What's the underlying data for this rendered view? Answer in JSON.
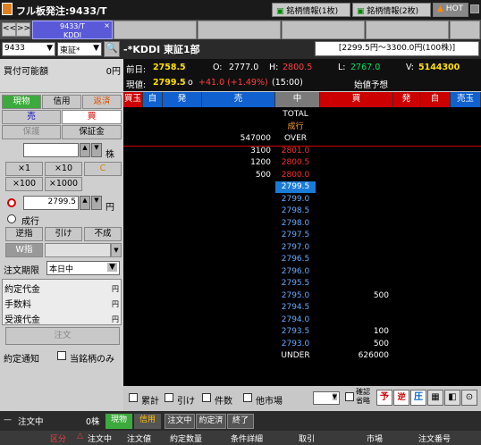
{
  "window": {
    "title": "フル板発注:9433/T",
    "btn_brand1": "銘柄情報(1枚)",
    "btn_brand2": "銘柄情報(2枚)",
    "btn_hot": "HOT"
  },
  "tabs": {
    "nav_prev": "<<",
    "nav_next": ">>",
    "active_code": "9433/T",
    "active_name": "KDDI",
    "close": "×"
  },
  "symbol": {
    "code": "9433",
    "market": "東証*",
    "name": "-*KDDI 東証1部",
    "price_range": "[2299.5円〜3300.0円(100株)]"
  },
  "account": {
    "buying_power_label": "買付可能額",
    "buying_power_value": "0円"
  },
  "quote": {
    "prev_label": "前日:",
    "prev": "2758.5",
    "open_label": "O:",
    "open": "2777.0",
    "high_label": "H:",
    "high": "2800.5",
    "low_label": "L:",
    "low": "2767.0",
    "vol_label": "V:",
    "vol": "5144300",
    "now_label": "現値:",
    "now": "2799.5",
    "now_mark": "o",
    "change": "+41.0 (+1.49%)",
    "time": "(15:00)",
    "status": "始値予想"
  },
  "order_panel": {
    "tab_genbutsu": "現物",
    "tab_shinyo": "信用",
    "tab_hensai": "返済",
    "sell": "売",
    "buy": "買",
    "hogo": "保護",
    "hoshokin": "保証金",
    "qty_value": "",
    "qty_unit": "株",
    "m1": "×1",
    "m10": "×10",
    "clear": "C",
    "m100": "×100",
    "m1000": "×1000",
    "price_value": "2799.5",
    "price_unit": "円",
    "market_order": "成行",
    "gyakusashi": "逆指",
    "hike": "引け",
    "funari": "不成",
    "w_sashi": "W指",
    "period_label": "注文期限",
    "period_value": "本日中",
    "yakujo_label": "約定代金",
    "fee_label": "手数料",
    "uke_label": "受渡代金",
    "yen1": "円",
    "yen2": "円",
    "yen3": "円",
    "order_btn": "注文",
    "notify_label": "約定通知",
    "this_only": "当銘柄のみ"
  },
  "book_header": {
    "kaidama": "買玉",
    "ji1": "自",
    "hatsu1": "発",
    "uri": "売",
    "naka": "中",
    "kai": "買",
    "hatsu2": "発",
    "ji2": "自",
    "uridama": "売玉"
  },
  "book_rows": [
    {
      "sell": "",
      "price": "TOTAL",
      "buy": "",
      "type": "label"
    },
    {
      "sell": "",
      "price": "成行",
      "buy": "",
      "type": "mkt"
    },
    {
      "sell": "547000",
      "price": "OVER",
      "buy": "",
      "type": "label"
    },
    {
      "sell": "3100",
      "price": "2801.0",
      "buy": "",
      "type": "ask"
    },
    {
      "sell": "1200",
      "price": "2800.5",
      "buy": "",
      "type": "ask"
    },
    {
      "sell": "500",
      "price": "2800.0",
      "buy": "",
      "type": "ask"
    },
    {
      "sell": "",
      "price": "2799.5",
      "buy": "",
      "type": "cur"
    },
    {
      "sell": "",
      "price": "2799.0",
      "buy": "",
      "type": "bid"
    },
    {
      "sell": "",
      "price": "2798.5",
      "buy": "",
      "type": "bid"
    },
    {
      "sell": "",
      "price": "2798.0",
      "buy": "",
      "type": "bid"
    },
    {
      "sell": "",
      "price": "2797.5",
      "buy": "",
      "type": "bid"
    },
    {
      "sell": "",
      "price": "2797.0",
      "buy": "",
      "type": "bid"
    },
    {
      "sell": "",
      "price": "2796.5",
      "buy": "",
      "type": "bid"
    },
    {
      "sell": "",
      "price": "2796.0",
      "buy": "",
      "type": "bid"
    },
    {
      "sell": "",
      "price": "2795.5",
      "buy": "",
      "type": "bid"
    },
    {
      "sell": "",
      "price": "2795.0",
      "buy": "500",
      "type": "bid"
    },
    {
      "sell": "",
      "price": "2794.5",
      "buy": "",
      "type": "bid"
    },
    {
      "sell": "",
      "price": "2794.0",
      "buy": "",
      "type": "bid"
    },
    {
      "sell": "",
      "price": "2793.5",
      "buy": "100",
      "type": "bid"
    },
    {
      "sell": "",
      "price": "2793.0",
      "buy": "500",
      "type": "bid"
    },
    {
      "sell": "",
      "price": "UNDER",
      "buy": "626000",
      "type": "label"
    }
  ],
  "options": {
    "ruikei": "累計",
    "hike": "引け",
    "kensu": "件数",
    "tashijo": "他市場",
    "kakunin": "確認省略",
    "yo": "予",
    "gyaku": "逆",
    "atsu": "圧"
  },
  "statusbar": {
    "chumon_chu": "注文中",
    "qty": "0株",
    "genbutsu": "現物",
    "shinyo": "信用",
    "chumon_chu2": "注文中",
    "yakujo_zumi": "約定済",
    "shuryo": "終了",
    "col_kubun": "区分",
    "col_chumon_chu": "注文中",
    "col_chumon_ne": "注文値",
    "col_yakujo": "約定数量",
    "col_joken": "条件詳細",
    "col_torikeshi": "取引",
    "col_shijo": "市場",
    "col_bango": "注文番号"
  }
}
